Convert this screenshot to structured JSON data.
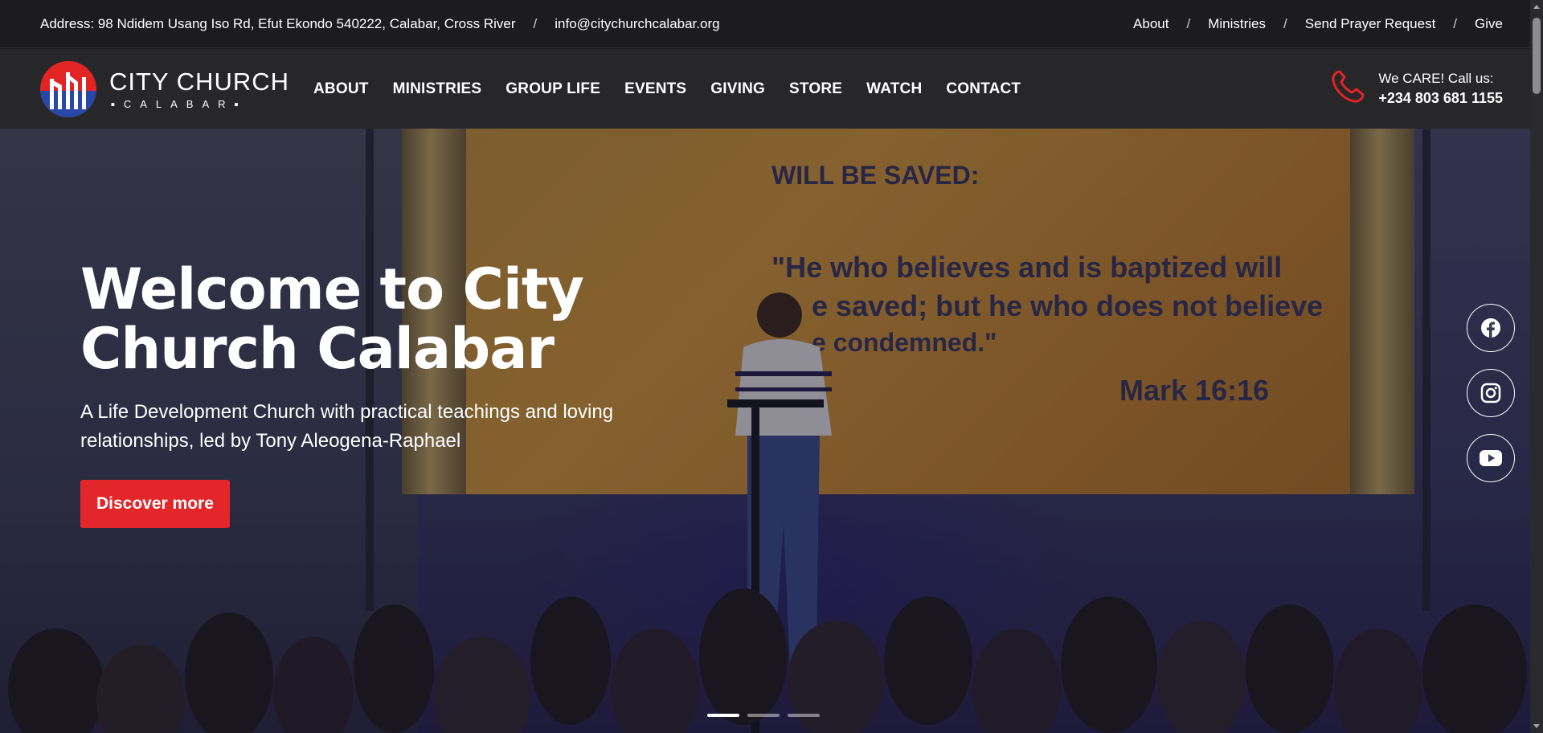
{
  "topbar": {
    "address": "Address: 98 Ndidem Usang Iso Rd, Efut Ekondo 540222, Calabar, Cross River",
    "separator": "/",
    "email": "info@citychurchcalabar.org",
    "links": [
      {
        "label": "About"
      },
      {
        "label": "Ministries"
      },
      {
        "label": "Send Prayer Request"
      },
      {
        "label": "Give"
      }
    ]
  },
  "brand": {
    "name": "CITY CHURCH",
    "subtitle": "CALABAR",
    "accent": "#e22424"
  },
  "nav": {
    "items": [
      {
        "label": "ABOUT"
      },
      {
        "label": "MINISTRIES"
      },
      {
        "label": "GROUP LIFE"
      },
      {
        "label": "EVENTS"
      },
      {
        "label": "GIVING"
      },
      {
        "label": "STORE"
      },
      {
        "label": "WATCH"
      },
      {
        "label": "CONTACT"
      }
    ]
  },
  "call": {
    "label": "We CARE! Call us:",
    "phone": "+234 803 681 1155",
    "icon": "phone-icon"
  },
  "hero": {
    "title": "Welcome to City Church Calabar",
    "subtitle": "A Life Development Church with practical teachings and loving relationships, led by Tony Aleogena-Raphael",
    "cta": "Discover more",
    "screen": {
      "line1": "WILL BE SAVED:",
      "line2": "\"He who believes and is baptized will",
      "line3": "e saved; but he who does not believe",
      "line4": "e condemned.\"",
      "ref": "Mark 16:16"
    },
    "slides": {
      "count": 3,
      "active": 0
    }
  },
  "social": [
    {
      "name": "facebook-icon"
    },
    {
      "name": "instagram-icon"
    },
    {
      "name": "youtube-icon"
    }
  ],
  "colors": {
    "primary_button": "#e3262a",
    "topbar_bg": "#1c1c1e",
    "navbar_bg": "#28282a"
  }
}
